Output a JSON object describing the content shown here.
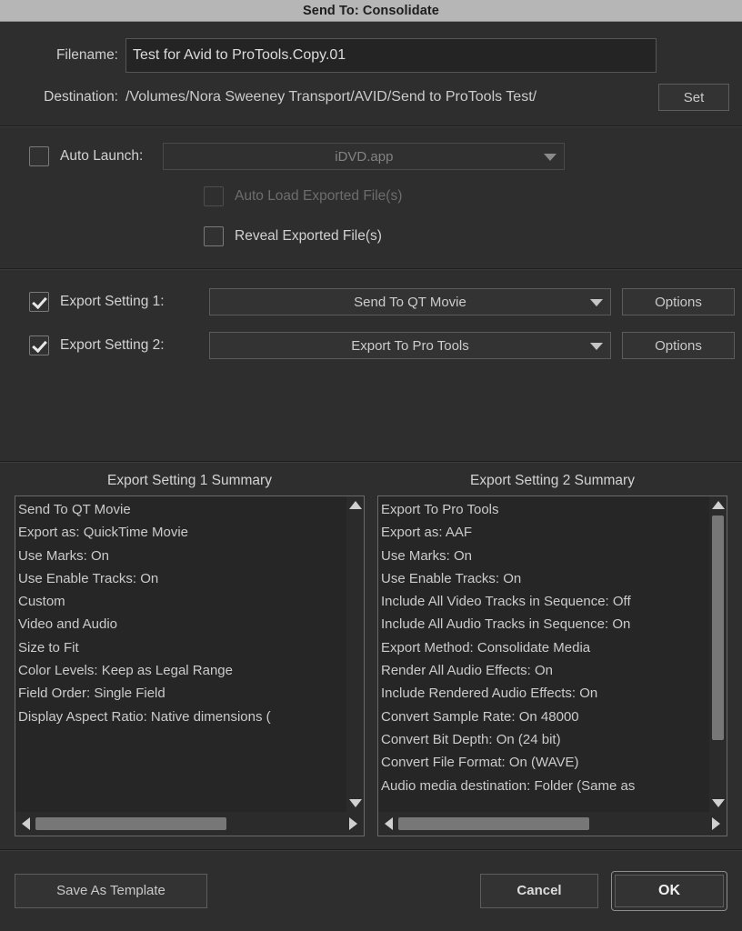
{
  "window": {
    "title": "Send To: Consolidate"
  },
  "file_section": {
    "filename_label": "Filename:",
    "filename_value": "Test for Avid to ProTools.Copy.01",
    "destination_label": "Destination:",
    "destination_value": "/Volumes/Nora Sweeney Transport/AVID/Send to ProTools Test/",
    "set_button": "Set"
  },
  "auto_section": {
    "auto_launch_label": "Auto Launch:",
    "auto_launch_checked": false,
    "auto_launch_app": "iDVD.app",
    "auto_load_label": "Auto Load Exported File(s)",
    "auto_load_checked": false,
    "reveal_label": "Reveal Exported File(s)",
    "reveal_checked": false
  },
  "export_section": {
    "setting1_label": "Export Setting 1:",
    "setting1_value": "Send To QT Movie",
    "setting1_checked": true,
    "setting1_options": "Options",
    "setting2_label": "Export Setting 2:",
    "setting2_value": "Export To Pro Tools",
    "setting2_checked": true,
    "setting2_options": "Options"
  },
  "summary_left": {
    "title": "Export Setting 1 Summary",
    "items": [
      "Send To QT Movie",
      "Export as: QuickTime Movie",
      "Use Marks: On",
      "Use Enable Tracks: On",
      "Custom",
      "Video and Audio",
      "Size to Fit",
      "Color Levels: Keep as Legal Range",
      "Field Order: Single Field",
      "Display Aspect Ratio: Native dimensions ("
    ]
  },
  "summary_right": {
    "title": "Export Setting 2 Summary",
    "items": [
      "Export To Pro Tools",
      "Export as: AAF",
      "Use Marks: On",
      "Use Enable Tracks: On",
      "Include All Video Tracks in Sequence: Off",
      "Include All Audio Tracks in Sequence: On",
      "Export Method: Consolidate Media",
      "Render All Audio Effects: On",
      "Include Rendered Audio Effects: On",
      "Convert Sample Rate: On  48000",
      "Convert Bit Depth: On  (24 bit)",
      "Convert File Format: On  (WAVE)",
      "Audio media destination: Folder (Same as"
    ]
  },
  "footer": {
    "save_as_template": "Save As Template",
    "cancel": "Cancel",
    "ok": "OK"
  },
  "colors": {
    "titlebar_bg": "#b6b6b6",
    "dialog_bg": "#2e2e2e",
    "field_bg": "#242424",
    "text": "#cfcfcf",
    "disabled_text": "#6d6d6d",
    "scroll_thumb": "#777777"
  }
}
